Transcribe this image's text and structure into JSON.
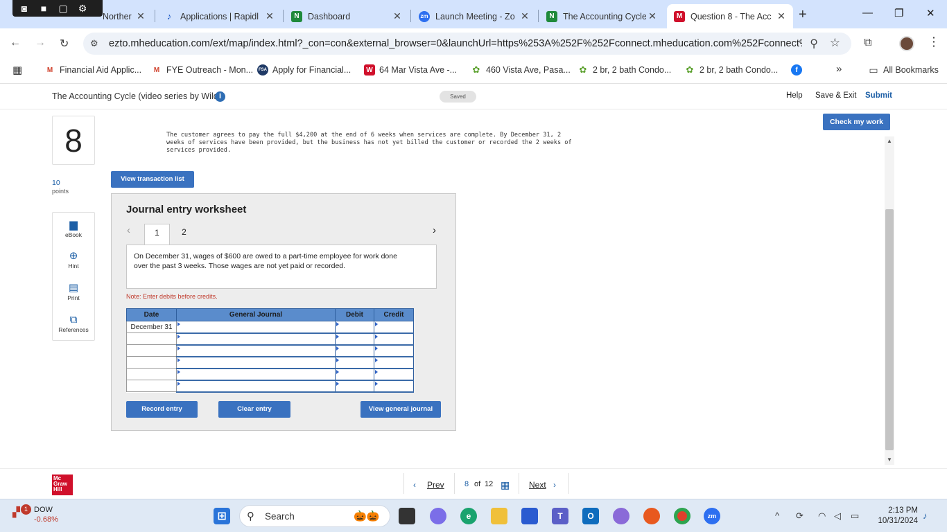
{
  "browser": {
    "recorder_icons": [
      "camera-icon",
      "video-icon",
      "window-icon",
      "gear-icon"
    ],
    "tabs": [
      {
        "title": "Norther",
        "favicon": "tab-favicon",
        "active": false
      },
      {
        "title": "Applications | Rapidl",
        "favicon": "rapidlink-favicon",
        "active": false
      },
      {
        "title": "Dashboard",
        "favicon": "N",
        "active": false
      },
      {
        "title": "Launch Meeting - Zo",
        "favicon": "zm",
        "active": false
      },
      {
        "title": "The Accounting Cycle",
        "favicon": "N",
        "active": false
      },
      {
        "title": "Question 8 - The Acc",
        "favicon": "M",
        "active": true
      }
    ],
    "url": "ezto.mheducation.com/ext/map/index.html?_con=con&external_browser=0&launchUrl=https%253A%252F%252Fconnect.mheducation.com%252Fconnect%25...",
    "bookmarks": [
      {
        "label": "Financial Aid Applic...",
        "icon": "gmail-icon"
      },
      {
        "label": "FYE Outreach - Mon...",
        "icon": "gmail-icon"
      },
      {
        "label": "Apply for Financial...",
        "icon": "fsa-icon"
      },
      {
        "label": "64 Mar Vista Ave -...",
        "icon": "W"
      },
      {
        "label": "460 Vista Ave, Pasa...",
        "icon": "realty-icon"
      },
      {
        "label": "2 br, 2 bath Condo...",
        "icon": "realty-icon"
      },
      {
        "label": "2 br, 2 bath Condo...",
        "icon": "realty-icon"
      },
      {
        "label": "",
        "icon": "facebook-icon"
      }
    ],
    "bookmarks_overflow": "»",
    "all_bookmarks": "All Bookmarks"
  },
  "app": {
    "title": "The Accounting Cycle (video series by Wild)",
    "saved": "Saved",
    "help": "Help",
    "save_exit": "Save & Exit",
    "submit": "Submit",
    "check_my_work": "Check my work"
  },
  "question": {
    "number": "8",
    "points_value": "10",
    "points_label": "points",
    "tools": [
      {
        "label": "eBook",
        "icon": "book-icon"
      },
      {
        "label": "Hint",
        "icon": "lifebuoy-icon"
      },
      {
        "label": "Print",
        "icon": "printer-icon"
      },
      {
        "label": "References",
        "icon": "copy-icon"
      }
    ],
    "prompt_text": "The customer agrees to pay the full $4,200 at the end of 6 weeks when services are complete. By December 31, 2\nweeks of services have been provided, but the business has not yet billed the customer or recorded the 2 weeks of\nservices provided.",
    "view_transaction_list": "View transaction list"
  },
  "worksheet": {
    "title": "Journal entry worksheet",
    "tabs": [
      "1",
      "2"
    ],
    "active_tab": "1",
    "description": "On December 31, wages of $600 are owed to a part-time employee for work done over the past 3 weeks. Those wages are not yet paid or recorded.",
    "note": "Note: Enter debits before credits.",
    "columns": [
      "Date",
      "General Journal",
      "Debit",
      "Credit"
    ],
    "rows": [
      {
        "date": "December 31",
        "account": "",
        "debit": "",
        "credit": ""
      },
      {
        "date": "",
        "account": "",
        "debit": "",
        "credit": ""
      },
      {
        "date": "",
        "account": "",
        "debit": "",
        "credit": ""
      },
      {
        "date": "",
        "account": "",
        "debit": "",
        "credit": ""
      },
      {
        "date": "",
        "account": "",
        "debit": "",
        "credit": ""
      },
      {
        "date": "",
        "account": "",
        "debit": "",
        "credit": ""
      }
    ],
    "record_entry": "Record entry",
    "clear_entry": "Clear entry",
    "view_general_journal": "View general journal"
  },
  "footer": {
    "prev": "Prev",
    "current": "8",
    "of": "of",
    "total": "12",
    "next": "Next",
    "logo_lines": [
      "Mc",
      "Graw",
      "Hill"
    ]
  },
  "taskbar": {
    "stock_name": "DOW",
    "stock_change": "-0.68%",
    "stock_badge": "1",
    "search_placeholder": "Search",
    "time": "2:13 PM",
    "date": "10/31/2024"
  }
}
